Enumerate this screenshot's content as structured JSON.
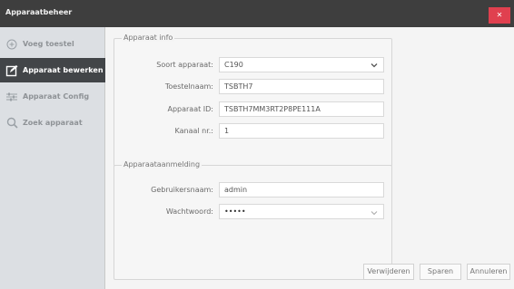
{
  "window": {
    "title": "Apparaatbeheer",
    "close_icon": "close-icon"
  },
  "sidebar": {
    "items": [
      {
        "label": "Voeg toestel",
        "icon": "plus-circle-icon",
        "active": false
      },
      {
        "label": "Apparaat bewerken",
        "icon": "edit-icon",
        "active": true
      },
      {
        "label": "Apparaat Config",
        "icon": "sliders-icon",
        "active": false
      },
      {
        "label": "Zoek apparaat",
        "icon": "search-icon",
        "active": false
      }
    ]
  },
  "device_info": {
    "legend": "Apparaat info",
    "type_label": "Soort apparaat:",
    "type_value": "C190",
    "name_label": "Toestelnaam:",
    "name_value": "TSBTH7",
    "id_label": "Apparaat ID:",
    "id_value": "TSBTH7MM3RT2P8PE111A",
    "channel_label": "Kanaal nr.:",
    "channel_value": "1"
  },
  "login": {
    "legend": "Apparaataanmelding",
    "user_label": "Gebruikersnaam:",
    "user_value": "admin",
    "password_label": "Wachtwoord:",
    "password_value": "•••••"
  },
  "buttons": {
    "delete": "Verwijderen",
    "save": "Sparen",
    "cancel": "Annuleren"
  },
  "colors": {
    "titlebar": "#3e3e3e",
    "close": "#e0404f",
    "active_nav": "#424548",
    "sidebar": "#dcdfe3"
  }
}
